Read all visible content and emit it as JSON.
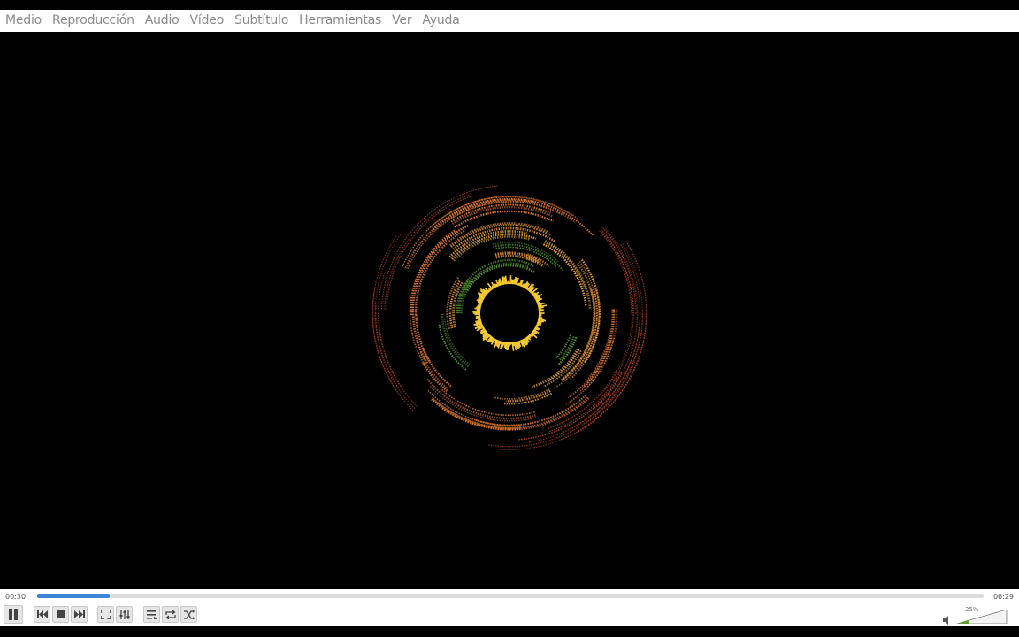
{
  "menu": {
    "items": [
      "Medio",
      "Reproducción",
      "Audio",
      "Vídeo",
      "Subtítulo",
      "Herramientas",
      "Ver",
      "Ayuda"
    ]
  },
  "player": {
    "elapsed": "00:30",
    "total": "06:29",
    "progress_fraction": 0.077,
    "volume_label": "25%",
    "volume_fraction": 0.25
  },
  "colors": {
    "accent": "#3a86d4",
    "viz_outer": "#c8461e",
    "viz_mid": "#e0782a",
    "viz_inner": "#f2c12e",
    "viz_green": "#5aa02c"
  },
  "icons": {
    "pause": "pause-icon",
    "previous": "skip-previous-icon",
    "stop": "stop-icon",
    "next": "skip-next-icon",
    "fullscreen": "fullscreen-icon",
    "equalizer": "extended-settings-icon",
    "playlist": "playlist-icon",
    "loop": "loop-icon",
    "shuffle": "shuffle-icon",
    "volume": "speaker-icon"
  }
}
